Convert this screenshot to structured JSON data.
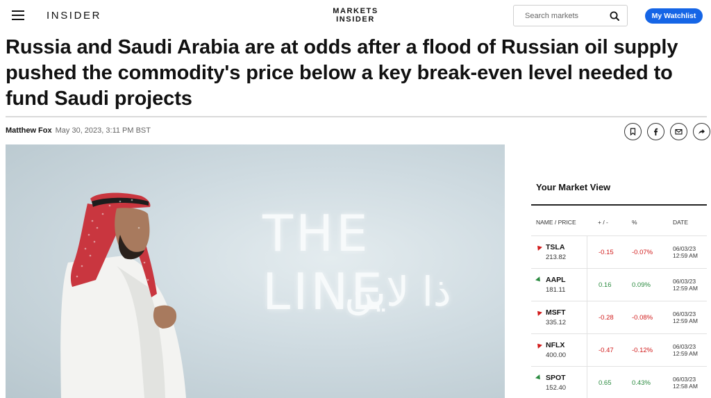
{
  "header": {
    "logo": "INSIDER",
    "markets_logo_line1": "MARKETS",
    "markets_logo_line2": "INSIDER",
    "search_placeholder": "Search markets",
    "watchlist_label": "My Watchlist",
    "accent_color": "#1565e6"
  },
  "article": {
    "headline": "Russia and Saudi Arabia are at odds after a flood of Russian oil supply pushed the commodity's price below a key break-even level needed to fund Saudi projects",
    "author": "Matthew Fox",
    "date": "May 30, 2023, 3:11 PM BST",
    "share_icons": [
      "bookmark-icon",
      "facebook-icon",
      "email-icon",
      "share-arrow-icon"
    ],
    "hero_text_en": "THE LINE",
    "hero_text_ar": "ذا لاين"
  },
  "market_view": {
    "title": "Your Market View",
    "headers": {
      "name": "NAME / PRICE",
      "chg": "+ / -",
      "pct": "%",
      "date": "DATE"
    },
    "rows": [
      {
        "symbol": "TSLA",
        "price": "213.82",
        "chg": "-0.15",
        "pct": "-0.07%",
        "date": "06/03/23",
        "time": "12:59 AM",
        "dir": "down"
      },
      {
        "symbol": "AAPL",
        "price": "181.11",
        "chg": "0.16",
        "pct": "0.09%",
        "date": "06/03/23",
        "time": "12:59 AM",
        "dir": "up"
      },
      {
        "symbol": "MSFT",
        "price": "335.12",
        "chg": "-0.28",
        "pct": "-0.08%",
        "date": "06/03/23",
        "time": "12:59 AM",
        "dir": "down"
      },
      {
        "symbol": "NFLX",
        "price": "400.00",
        "chg": "-0.47",
        "pct": "-0.12%",
        "date": "06/03/23",
        "time": "12:59 AM",
        "dir": "down"
      },
      {
        "symbol": "SPOT",
        "price": "152.40",
        "chg": "0.65",
        "pct": "0.43%",
        "date": "06/03/23",
        "time": "12:58 AM",
        "dir": "up"
      }
    ],
    "colors": {
      "negative": "#d11a1a",
      "positive": "#2a8a3f"
    }
  }
}
